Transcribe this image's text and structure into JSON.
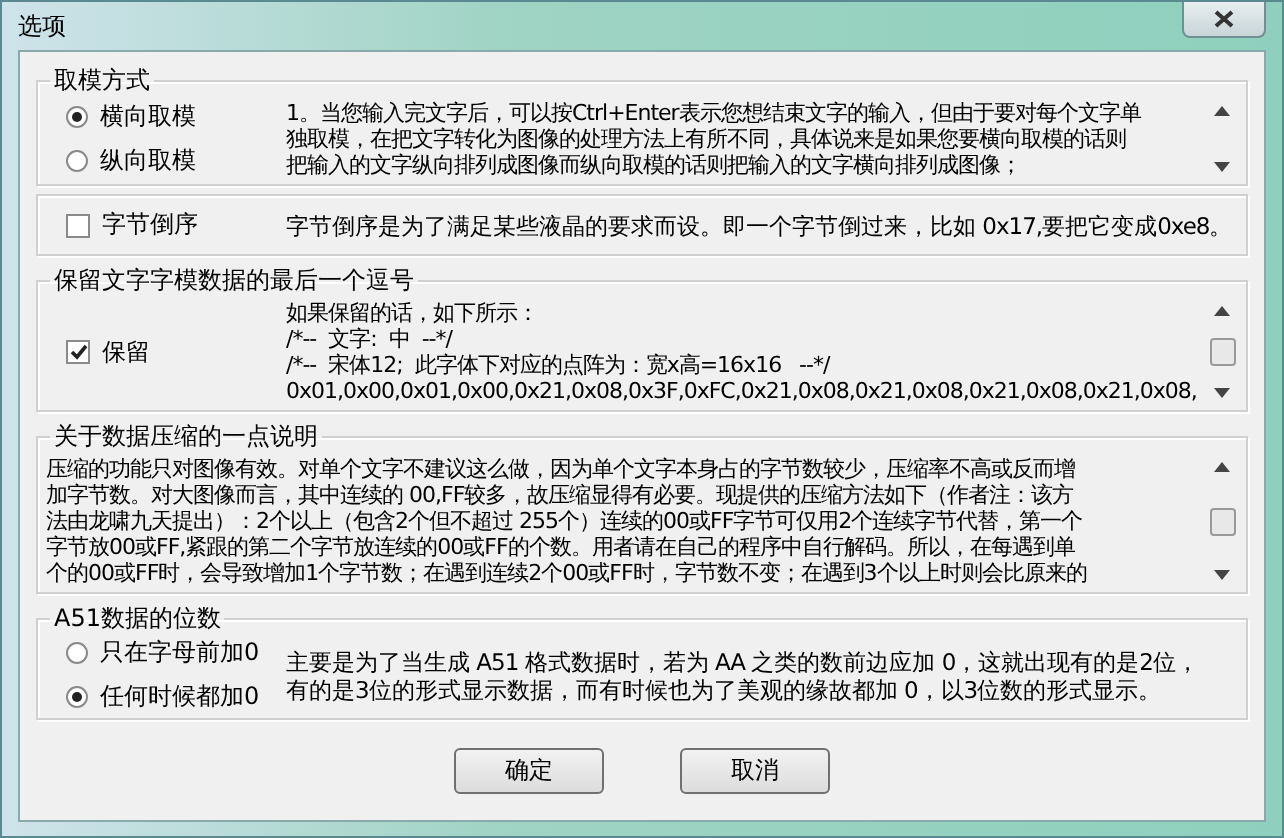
{
  "window": {
    "title": "选项"
  },
  "groups": [
    {
      "kind": "radio",
      "scrollbar": true,
      "title": "取模方式",
      "options": [
        {
          "label": "横向取模",
          "selected": true
        },
        {
          "label": "纵向取模",
          "selected": false
        }
      ],
      "lines": [
        "1。当您输入完文字后，可以按Ctrl+Enter表示您想结束文字的输入，但由于要对每个文字单",
        "独取模，在把文字转化为图像的处理方法上有所不同，具体说来是如果您要横向取模的话则",
        "把输入的文字纵向排列成图像而纵向取模的话则把输入的文字横向排列成图像；"
      ]
    },
    {
      "kind": "checkbox",
      "scrollbar": false,
      "options": [
        {
          "label": "字节倒序",
          "checked": false
        }
      ],
      "lines": [
        "字节倒序是为了满足某些液晶的要求而设。即一个字节倒过来，比如 0x17,要把它变成0xe8。"
      ]
    },
    {
      "kind": "checkbox",
      "scrollbar": true,
      "title": "保留文字字模数据的最后一个逗号",
      "options": [
        {
          "label": "保留",
          "checked": true
        }
      ],
      "lines": [
        "如果保留的话，如下所示：",
        "/*--  文字:  中  --*/",
        "/*--  宋体12;  此字体下对应的点阵为：宽x高=16x16   --*/",
        "0x01,0x00,0x01,0x00,0x21,0x08,0x3F,0xFC,0x21,0x08,0x21,0x08,0x21,0x08,0x21,0x08,"
      ]
    },
    {
      "kind": "text",
      "scrollbar": true,
      "title": "关于数据压缩的一点说明",
      "lines": [
        "压缩的功能只对图像有效。对单个文字不建议这么做，因为单个文字本身占的字节数较少，压缩率不高或反而增",
        "加字节数。对大图像而言，其中连续的 00,FF较多，故压缩显得有必要。现提供的压缩方法如下（作者注：该方",
        "法由龙啸九天提出）：2个以上（包含2个但不超过 255个）连续的00或FF字节可仅用2个连续字节代替，第一个",
        "字节放00或FF,紧跟的第二个字节放连续的00或FF的个数。用者请在自己的程序中自行解码。所以，在每遇到单",
        "个的00或FF时，会导致增加1个字节数；在遇到连续2个00或FF时，字节数不变；在遇到3个以上时则会比原来的"
      ]
    },
    {
      "kind": "radio",
      "scrollbar": false,
      "title": "A51数据的位数",
      "options": [
        {
          "label": "只在字母前加0",
          "selected": false
        },
        {
          "label": "任何时候都加0",
          "selected": true
        }
      ],
      "lines": [
        "主要是为了当生成 A51 格式数据时，若为 AA 之类的数前边应加 0，这就出现有的是2位，",
        "有的是3位的形式显示数据，而有时候也为了美观的缘故都加 0，以3位数的形式显示。"
      ]
    }
  ],
  "buttons": [
    "确定",
    "取消"
  ]
}
